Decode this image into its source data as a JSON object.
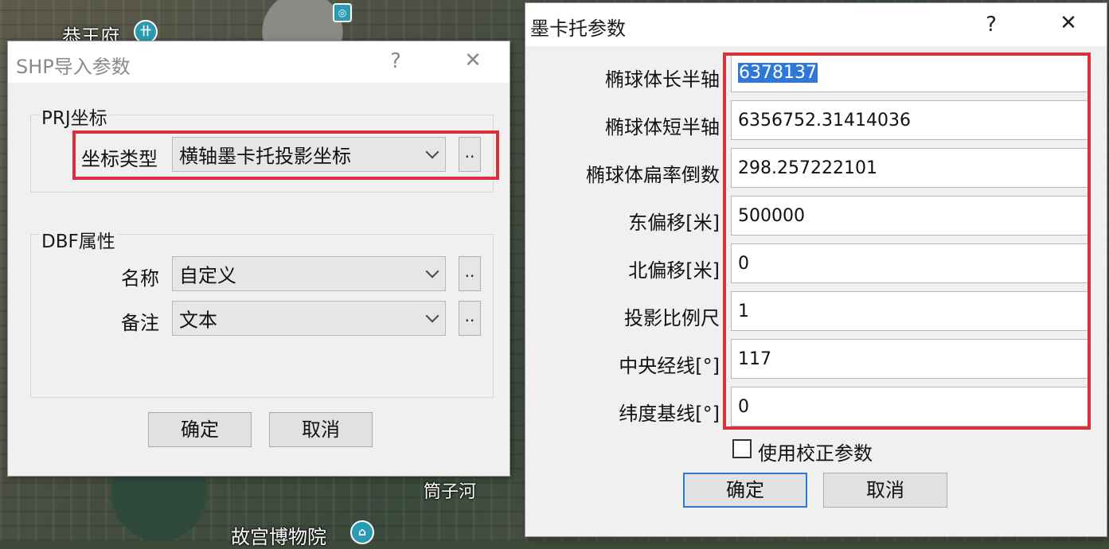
{
  "map": {
    "labels": [
      "恭王府",
      "筒子河",
      "故宫博物院"
    ]
  },
  "shp_dialog": {
    "title": "SHP导入参数",
    "help": "?",
    "close": "✕",
    "prj_group": {
      "title": "PRJ坐标",
      "coord_type_label": "坐标类型",
      "coord_type_value": "横轴墨卡托投影坐标",
      "more": ".."
    },
    "dbf_group": {
      "title": "DBF属性",
      "name_label": "名称",
      "name_value": "自定义",
      "remark_label": "备注",
      "remark_value": "文本",
      "more": ".."
    },
    "ok": "确定",
    "cancel": "取消"
  },
  "mercator_dialog": {
    "title": "墨卡托参数",
    "help": "?",
    "close": "✕",
    "fields": [
      {
        "label": "椭球体长半轴",
        "value": "6378137",
        "selected": true
      },
      {
        "label": "椭球体短半轴",
        "value": "6356752.31414036"
      },
      {
        "label": "椭球体扁率倒数",
        "value": "298.257222101"
      },
      {
        "label": "东偏移[米]",
        "value": "500000"
      },
      {
        "label": "北偏移[米]",
        "value": "0"
      },
      {
        "label": "投影比例尺",
        "value": "1"
      },
      {
        "label": "中央经线[°]",
        "value": "117"
      },
      {
        "label": "纬度基线[°]",
        "value": "0"
      }
    ],
    "checkbox_label": "使用校正参数",
    "checkbox_checked": false,
    "ok": "确定",
    "cancel": "取消"
  },
  "colors": {
    "highlight": "#d9303a",
    "selection": "#3078d8",
    "default_button_border": "#2a78d6"
  }
}
